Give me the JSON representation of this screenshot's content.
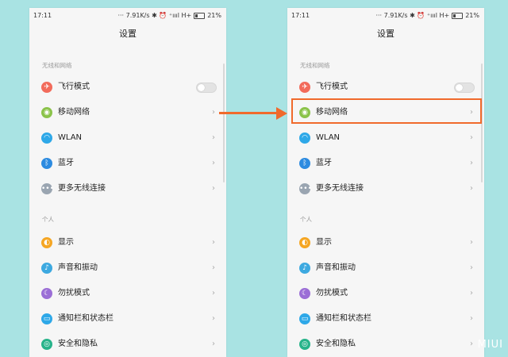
{
  "status": {
    "time": "17:11",
    "right": "··· 7.91K/s ✱ ⏰ ⁺ıııl H+",
    "battery": "21%"
  },
  "title": "设置",
  "sections": {
    "wireless": "无线和网络",
    "personal": "个人"
  },
  "items": [
    {
      "label": "飞行模式",
      "icon": "airplane-icon",
      "color": "#f26b5b",
      "control": "toggle",
      "toggle_on": false
    },
    {
      "label": "移动网络",
      "icon": "mobile-network-icon",
      "color": "#8bc34a",
      "control": "chevron"
    },
    {
      "label": "WLAN",
      "icon": "wifi-icon",
      "color": "#2ea8e8",
      "control": "chevron"
    },
    {
      "label": "蓝牙",
      "icon": "bluetooth-icon",
      "color": "#2d8be0",
      "control": "chevron"
    },
    {
      "label": "更多无线连接",
      "icon": "more-icon",
      "color": "#9aa5b1",
      "control": "chevron"
    },
    {
      "label": "显示",
      "icon": "display-icon",
      "color": "#f5a623",
      "control": "chevron"
    },
    {
      "label": "声音和振动",
      "icon": "sound-icon",
      "color": "#3da9e0",
      "control": "chevron"
    },
    {
      "label": "勿扰模式",
      "icon": "moon-icon",
      "color": "#9b6ed6",
      "control": "chevron"
    },
    {
      "label": "通知栏和状态栏",
      "icon": "notification-icon",
      "color": "#2ea8e8",
      "control": "chevron"
    },
    {
      "label": "安全和隐私",
      "icon": "security-icon",
      "color": "#27b38a",
      "control": "chevron"
    }
  ],
  "chevron": "›",
  "toggle_icon": "",
  "watermark": "MIUI",
  "highlight_color": "#f06a2c"
}
